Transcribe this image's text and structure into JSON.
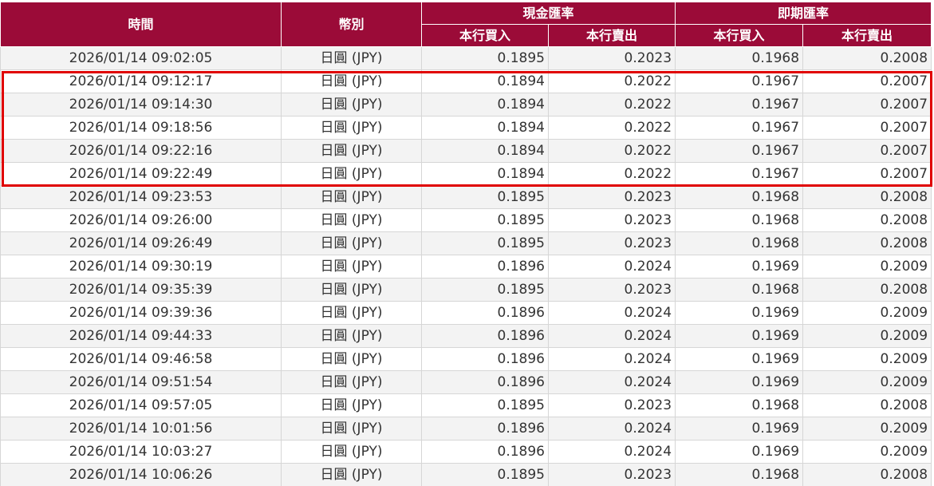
{
  "header": {
    "time": "時間",
    "currency": "幣別",
    "cash_rate": "現金匯率",
    "spot_rate": "即期匯率",
    "buy": "本行買入",
    "sell": "本行賣出"
  },
  "highlight_color": "#e00000",
  "header_color": "#9b0b38",
  "rows": [
    {
      "time": "2026/01/14 09:02:05",
      "currency": "日圓 (JPY)",
      "cash_buy": "0.1895",
      "cash_sell": "0.2023",
      "spot_buy": "0.1968",
      "spot_sell": "0.2008"
    },
    {
      "time": "2026/01/14 09:12:17",
      "currency": "日圓 (JPY)",
      "cash_buy": "0.1894",
      "cash_sell": "0.2022",
      "spot_buy": "0.1967",
      "spot_sell": "0.2007"
    },
    {
      "time": "2026/01/14 09:14:30",
      "currency": "日圓 (JPY)",
      "cash_buy": "0.1894",
      "cash_sell": "0.2022",
      "spot_buy": "0.1967",
      "spot_sell": "0.2007"
    },
    {
      "time": "2026/01/14 09:18:56",
      "currency": "日圓 (JPY)",
      "cash_buy": "0.1894",
      "cash_sell": "0.2022",
      "spot_buy": "0.1967",
      "spot_sell": "0.2007"
    },
    {
      "time": "2026/01/14 09:22:16",
      "currency": "日圓 (JPY)",
      "cash_buy": "0.1894",
      "cash_sell": "0.2022",
      "spot_buy": "0.1967",
      "spot_sell": "0.2007"
    },
    {
      "time": "2026/01/14 09:22:49",
      "currency": "日圓 (JPY)",
      "cash_buy": "0.1894",
      "cash_sell": "0.2022",
      "spot_buy": "0.1967",
      "spot_sell": "0.2007"
    },
    {
      "time": "2026/01/14 09:23:53",
      "currency": "日圓 (JPY)",
      "cash_buy": "0.1895",
      "cash_sell": "0.2023",
      "spot_buy": "0.1968",
      "spot_sell": "0.2008"
    },
    {
      "time": "2026/01/14 09:26:00",
      "currency": "日圓 (JPY)",
      "cash_buy": "0.1895",
      "cash_sell": "0.2023",
      "spot_buy": "0.1968",
      "spot_sell": "0.2008"
    },
    {
      "time": "2026/01/14 09:26:49",
      "currency": "日圓 (JPY)",
      "cash_buy": "0.1895",
      "cash_sell": "0.2023",
      "spot_buy": "0.1968",
      "spot_sell": "0.2008"
    },
    {
      "time": "2026/01/14 09:30:19",
      "currency": "日圓 (JPY)",
      "cash_buy": "0.1896",
      "cash_sell": "0.2024",
      "spot_buy": "0.1969",
      "spot_sell": "0.2009"
    },
    {
      "time": "2026/01/14 09:35:39",
      "currency": "日圓 (JPY)",
      "cash_buy": "0.1895",
      "cash_sell": "0.2023",
      "spot_buy": "0.1968",
      "spot_sell": "0.2008"
    },
    {
      "time": "2026/01/14 09:39:36",
      "currency": "日圓 (JPY)",
      "cash_buy": "0.1896",
      "cash_sell": "0.2024",
      "spot_buy": "0.1969",
      "spot_sell": "0.2009"
    },
    {
      "time": "2026/01/14 09:44:33",
      "currency": "日圓 (JPY)",
      "cash_buy": "0.1896",
      "cash_sell": "0.2024",
      "spot_buy": "0.1969",
      "spot_sell": "0.2009"
    },
    {
      "time": "2026/01/14 09:46:58",
      "currency": "日圓 (JPY)",
      "cash_buy": "0.1896",
      "cash_sell": "0.2024",
      "spot_buy": "0.1969",
      "spot_sell": "0.2009"
    },
    {
      "time": "2026/01/14 09:51:54",
      "currency": "日圓 (JPY)",
      "cash_buy": "0.1896",
      "cash_sell": "0.2024",
      "spot_buy": "0.1969",
      "spot_sell": "0.2009"
    },
    {
      "time": "2026/01/14 09:57:05",
      "currency": "日圓 (JPY)",
      "cash_buy": "0.1895",
      "cash_sell": "0.2023",
      "spot_buy": "0.1968",
      "spot_sell": "0.2008"
    },
    {
      "time": "2026/01/14 10:01:56",
      "currency": "日圓 (JPY)",
      "cash_buy": "0.1896",
      "cash_sell": "0.2024",
      "spot_buy": "0.1969",
      "spot_sell": "0.2009"
    },
    {
      "time": "2026/01/14 10:03:27",
      "currency": "日圓 (JPY)",
      "cash_buy": "0.1896",
      "cash_sell": "0.2024",
      "spot_buy": "0.1969",
      "spot_sell": "0.2009"
    },
    {
      "time": "2026/01/14 10:06:26",
      "currency": "日圓 (JPY)",
      "cash_buy": "0.1895",
      "cash_sell": "0.2023",
      "spot_buy": "0.1968",
      "spot_sell": "0.2008"
    }
  ]
}
